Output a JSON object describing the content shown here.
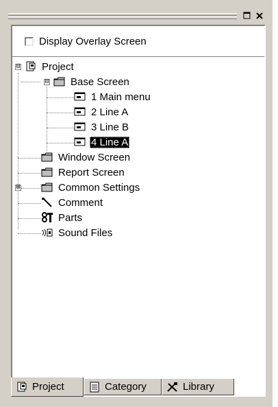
{
  "window": {
    "restore_button": "restore",
    "close_button": "close"
  },
  "overlay_checkbox": {
    "label": "Display Overlay Screen",
    "checked": false
  },
  "tree": {
    "root": {
      "label": "Project",
      "expander": "⊟",
      "icon": "project-icon"
    },
    "base_screen": {
      "label": "Base Screen",
      "expander": "⊟",
      "icon": "folder-icon"
    },
    "screens": [
      {
        "label": "1 Main menu",
        "icon": "screen-icon",
        "selected": false
      },
      {
        "label": "2 Line A",
        "icon": "screen-icon",
        "selected": false
      },
      {
        "label": "3 Line B",
        "icon": "screen-icon",
        "selected": false
      },
      {
        "label": "4 Line A",
        "icon": "screen-icon",
        "selected": true
      }
    ],
    "window_screen": {
      "label": "Window Screen",
      "icon": "folder-icon"
    },
    "report_screen": {
      "label": "Report Screen",
      "icon": "folder-icon"
    },
    "common_settings": {
      "label": "Common Settings",
      "expander": "⊞",
      "icon": "folder-icon"
    },
    "comment": {
      "label": "Comment",
      "icon": "comment-icon"
    },
    "parts": {
      "label": "Parts",
      "icon": "parts-icon"
    },
    "sound_files": {
      "label": "Sound Files",
      "icon": "sound-icon"
    }
  },
  "tabs": [
    {
      "label": "Project",
      "icon": "project-icon",
      "active": true
    },
    {
      "label": "Category",
      "icon": "category-icon",
      "active": false
    },
    {
      "label": "Library",
      "icon": "library-icon",
      "active": false
    }
  ],
  "colors": {
    "face": "#d4d0c8",
    "shadow": "#808080",
    "highlight": "#ffffff",
    "selection": "#000000"
  }
}
